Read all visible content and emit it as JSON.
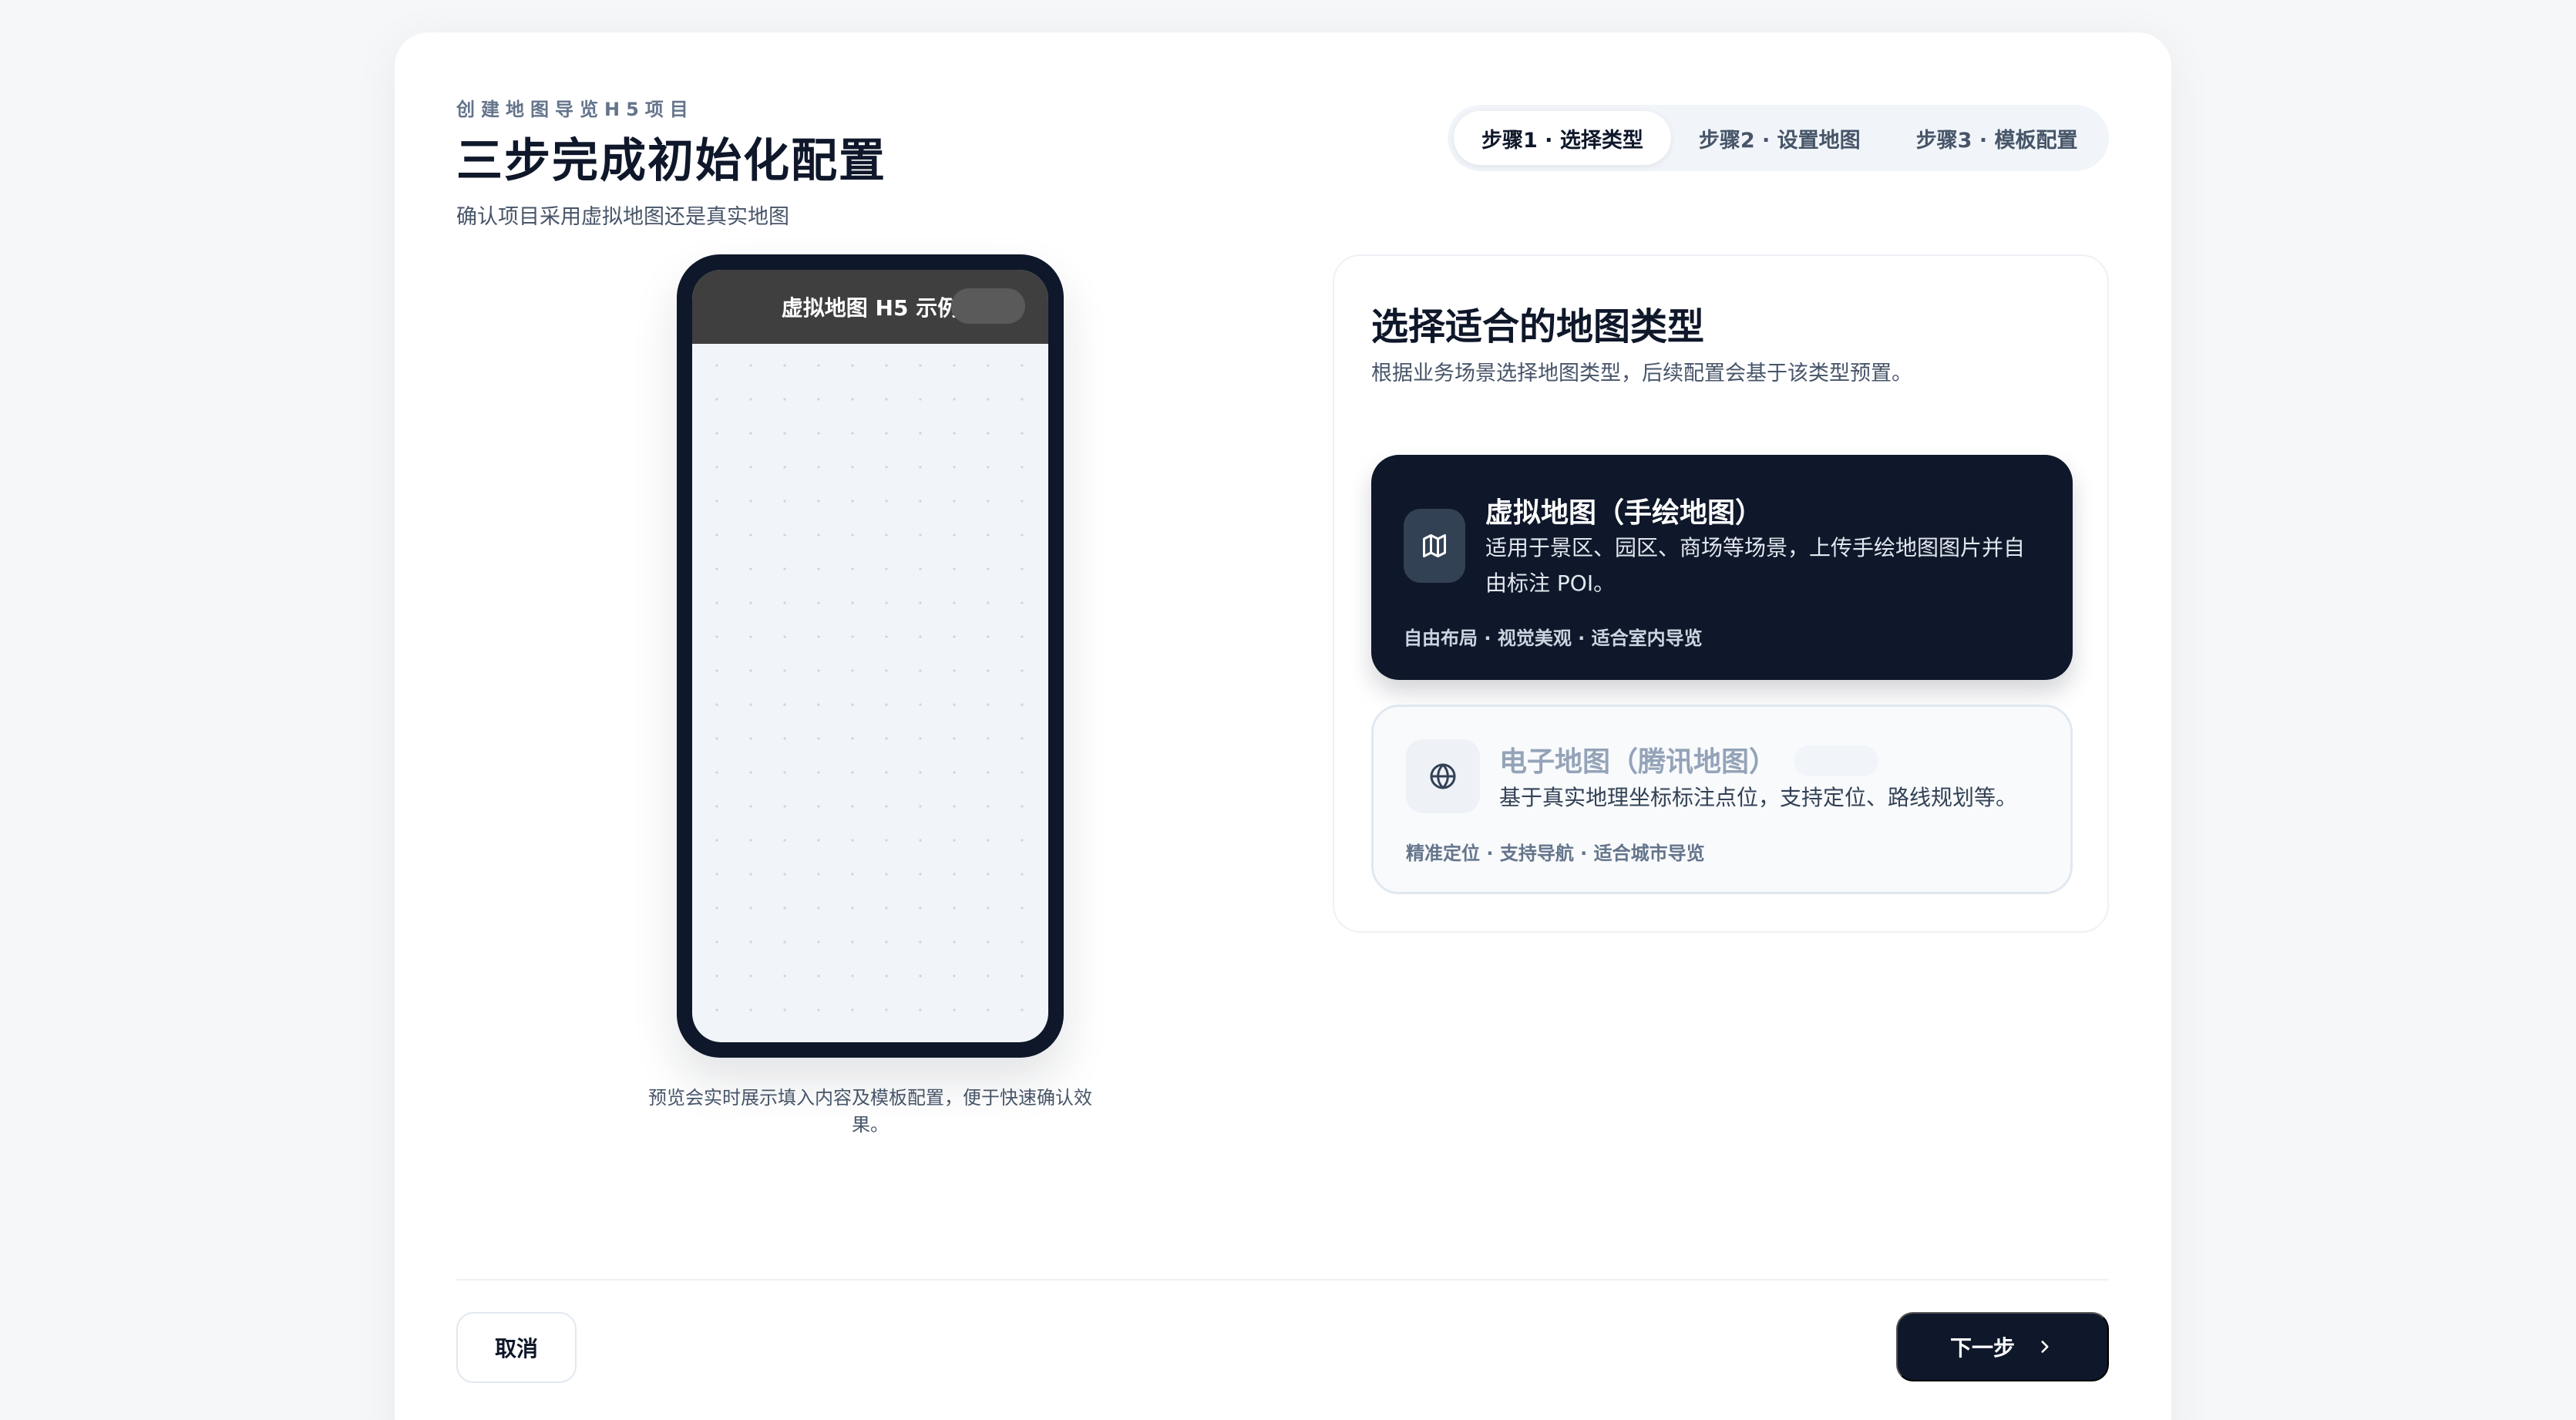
{
  "header": {
    "eyebrow": "创建地图导览H5项目",
    "title": "三步完成初始化配置",
    "subtitle": "确认项目采用虚拟地图还是真实地图"
  },
  "steps": [
    {
      "label": "步骤1 · 选择类型",
      "active": true
    },
    {
      "label": "步骤2 · 设置地图",
      "active": false
    },
    {
      "label": "步骤3 · 模板配置",
      "active": false
    }
  ],
  "preview": {
    "phone_title": "虚拟地图 H5 示例",
    "caption": "预览会实时展示填入内容及模板配置，便于快速确认效果。"
  },
  "panel": {
    "title": "选择适合的地图类型",
    "subtitle": "根据业务场景选择地图类型，后续配置会基于该类型预置。",
    "options": [
      {
        "icon": "map-icon",
        "title": "虚拟地图（手绘地图）",
        "desc": "适用于景区、园区、商场等场景，上传手绘地图图片并自由标注 POI。",
        "tags": "自由布局 · 视觉美观 · 适合室内导览",
        "selected": true
      },
      {
        "icon": "globe-icon",
        "title": "电子地图（腾讯地图）",
        "desc": "基于真实地理坐标标注点位，支持定位、路线规划等。",
        "tags": "精准定位 · 支持导航 · 适合城市导览",
        "selected": false
      }
    ]
  },
  "footer": {
    "cancel_label": "取消",
    "next_label": "下一步"
  },
  "colors": {
    "primary": "#0f172a",
    "muted": "#64748b",
    "surface": "#f1f5f9"
  }
}
